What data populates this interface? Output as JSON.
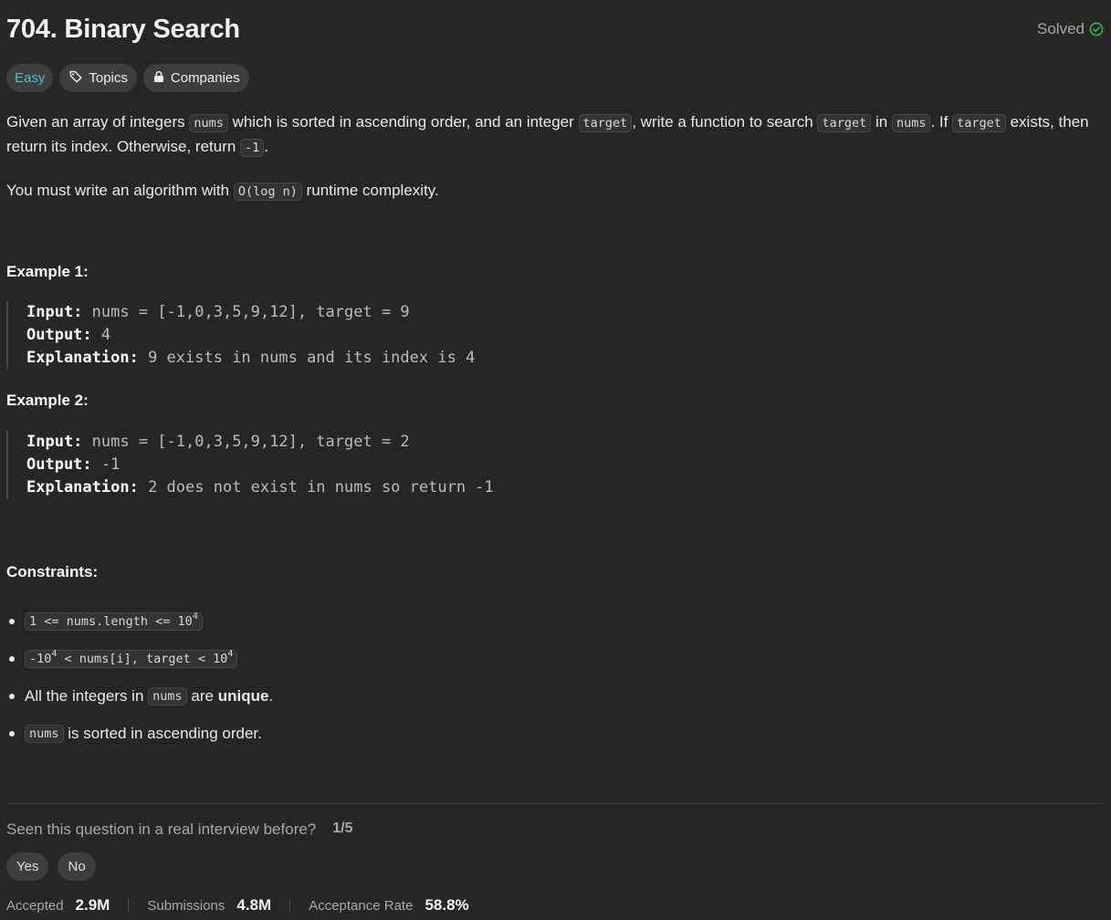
{
  "problem": {
    "title": "704. Binary Search",
    "status": "Solved",
    "difficulty": "Easy",
    "topics_label": "Topics",
    "companies_label": "Companies",
    "accent_colors": {
      "easy": "#46c6c2",
      "solved": "#2cbb5d"
    }
  },
  "description": {
    "p1_a": "Given an array of integers ",
    "p1_code1": "nums",
    "p1_b": " which is sorted in ascending order, and an integer ",
    "p1_code2": "target",
    "p1_c": ", write a function to search ",
    "p1_code3": "target",
    "p1_d": " in ",
    "p1_code4": "nums",
    "p1_e": ". If ",
    "p1_code5": "target",
    "p1_f": " exists, then return its index. Otherwise, return ",
    "p1_code6": "-1",
    "p1_g": ".",
    "p2_a": "You must write an algorithm with ",
    "p2_code": "O(log n)",
    "p2_b": " runtime complexity."
  },
  "examples": [
    {
      "title": "Example 1:",
      "input_label": "Input:",
      "input": "nums = [-1,0,3,5,9,12], target = 9",
      "output_label": "Output:",
      "output": "4",
      "explanation_label": "Explanation:",
      "explanation": "9 exists in nums and its index is 4"
    },
    {
      "title": "Example 2:",
      "input_label": "Input:",
      "input": "nums = [-1,0,3,5,9,12], target = 2",
      "output_label": "Output:",
      "output": "-1",
      "explanation_label": "Explanation:",
      "explanation": "2 does not exist in nums so return -1"
    }
  ],
  "constraints": {
    "title": "Constraints:",
    "c1_code": "1 <= nums.length <= 10",
    "c1_sup": "4",
    "c2_code_a": "-10",
    "c2_sup_a": "4",
    "c2_code_b": " < nums[i], target < 10",
    "c2_sup_b": "4",
    "c3_a": "All the integers in ",
    "c3_code": "nums",
    "c3_b": " are ",
    "c3_bold": "unique",
    "c3_c": ".",
    "c4_code": "nums",
    "c4_b": " is sorted in ascending order."
  },
  "feedback": {
    "question": "Seen this question in a real interview before?",
    "ratio": "1/5",
    "yes": "Yes",
    "no": "No"
  },
  "stats": {
    "accepted_label": "Accepted",
    "accepted": "2.9M",
    "submissions_label": "Submissions",
    "submissions": "4.8M",
    "rate_label": "Acceptance Rate",
    "rate": "58.8%"
  }
}
